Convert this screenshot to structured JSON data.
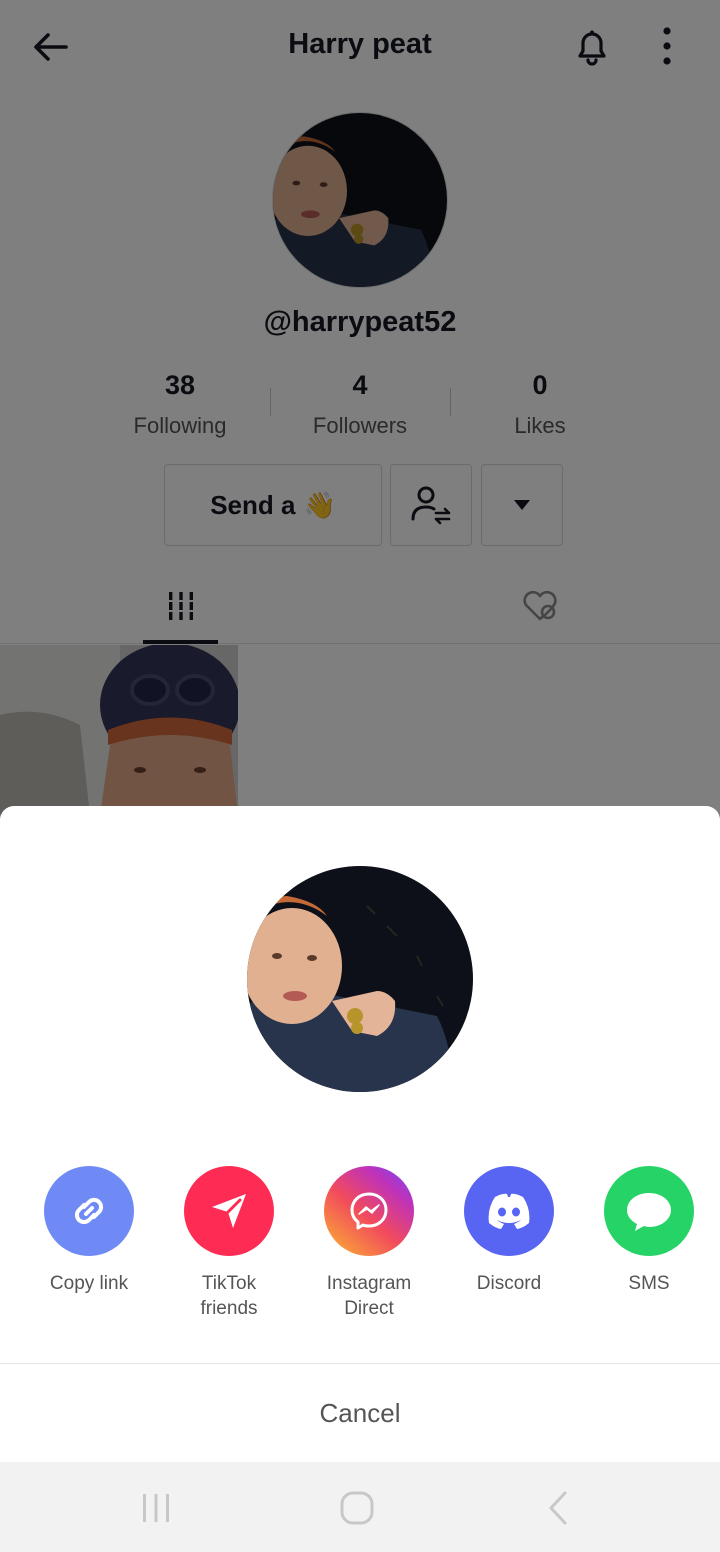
{
  "header": {
    "title": "Harry peat"
  },
  "profile": {
    "username": "@harrypeat52",
    "stats": [
      {
        "value": "38",
        "label": "Following"
      },
      {
        "value": "4",
        "label": "Followers"
      },
      {
        "value": "0",
        "label": "Likes"
      }
    ],
    "wave_button_label": "Send a",
    "wave_emoji": "👋"
  },
  "share_sheet": {
    "options": [
      {
        "label": "Copy link",
        "icon": "link-icon",
        "color": "#6F8AF5"
      },
      {
        "label": "TikTok\nfriends",
        "icon": "send-arrow-icon",
        "color": "#FE2C55"
      },
      {
        "label": "Instagram\nDirect",
        "icon": "messenger-icon",
        "color": "#C13584"
      },
      {
        "label": "Discord",
        "icon": "discord-icon",
        "color": "#5865F2"
      },
      {
        "label": "SMS",
        "icon": "chat-bubble-icon",
        "color": "#25D366"
      }
    ],
    "cancel_label": "Cancel"
  },
  "colors": {
    "overlay": "rgba(0,0,0,0.5)",
    "text_primary": "#161823"
  }
}
